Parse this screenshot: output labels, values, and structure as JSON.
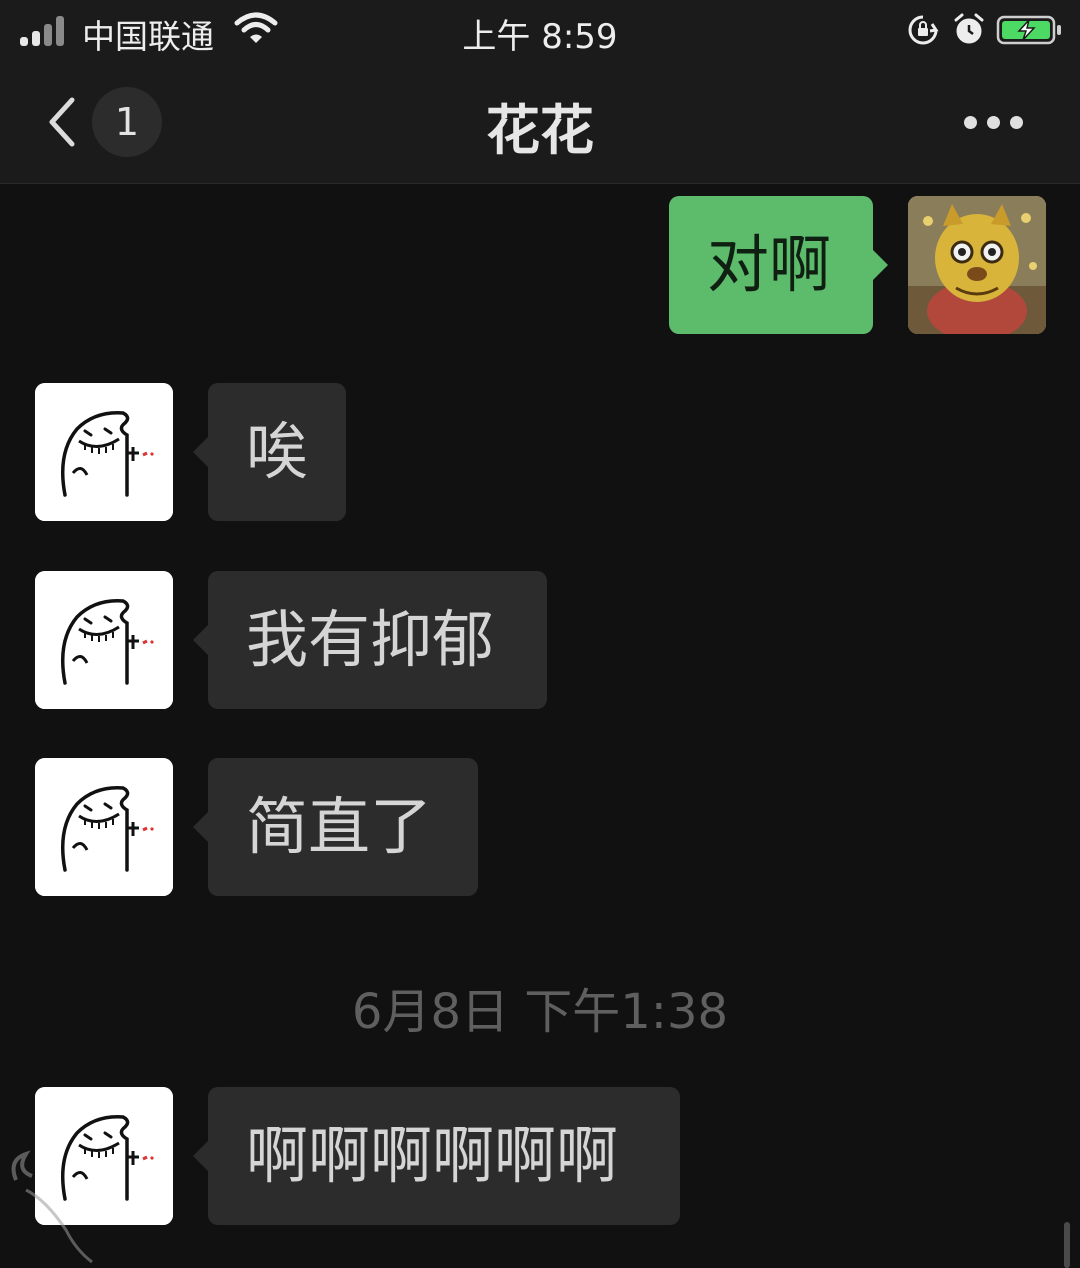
{
  "status_bar": {
    "carrier": "中国联通",
    "time": "上午 8:59",
    "icons": [
      "signal-icon",
      "wifi-icon",
      "rotation-lock-icon",
      "alarm-icon",
      "battery-charging-icon"
    ],
    "battery_color": "#4cd964"
  },
  "nav": {
    "back_icon": "chevron-left-icon",
    "unread_count": "1",
    "title": "花花",
    "more_icon": "more-dots-icon"
  },
  "messages": [
    {
      "from": "me",
      "text": "对啊",
      "avatar": "tiger-costume-avatar"
    },
    {
      "from": "contact",
      "text": "唉",
      "avatar": "sketch-face-avatar"
    },
    {
      "from": "contact",
      "text": "我有抑郁",
      "avatar": "sketch-face-avatar"
    },
    {
      "from": "contact",
      "text": "简直了",
      "avatar": "sketch-face-avatar"
    },
    {
      "from": "contact",
      "text": "啊啊啊啊啊啊",
      "avatar": "sketch-face-avatar"
    }
  ],
  "timestamp": "6月8日 下午1:38",
  "colors": {
    "background": "#111111",
    "bar": "#1b1b1b",
    "incoming_bubble": "#2c2c2c",
    "outgoing_bubble": "#5dbb6c",
    "timestamp_text": "#5f5f5f"
  }
}
